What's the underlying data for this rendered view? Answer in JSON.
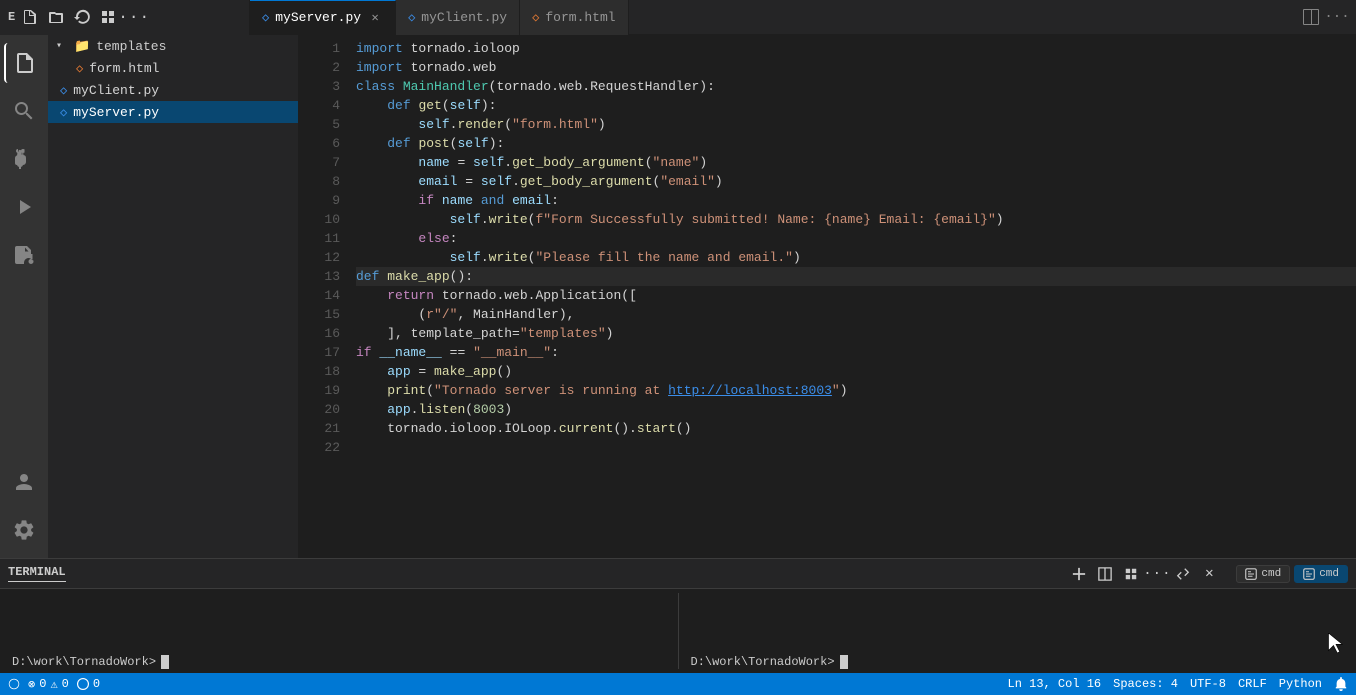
{
  "titlebar": {
    "explorer_label": "E",
    "buttons": [
      "new-file",
      "new-folder",
      "refresh",
      "collapse"
    ],
    "more_label": "..."
  },
  "tabs": [
    {
      "id": "myServer",
      "label": "myServer.py",
      "icon": "py",
      "active": true,
      "closable": true
    },
    {
      "id": "myClient",
      "label": "myClient.py",
      "icon": "py",
      "active": false,
      "closable": false
    },
    {
      "id": "form",
      "label": "form.html",
      "icon": "html",
      "active": false,
      "closable": false
    }
  ],
  "sidebar": {
    "tree": [
      {
        "type": "folder",
        "label": "templates",
        "expanded": true,
        "indent": 0
      },
      {
        "type": "file",
        "label": "form.html",
        "icon": "html",
        "indent": 1
      },
      {
        "type": "file",
        "label": "myClient.py",
        "icon": "py",
        "indent": 0
      },
      {
        "type": "file",
        "label": "myServer.py",
        "icon": "py",
        "indent": 0,
        "selected": true
      }
    ]
  },
  "editor": {
    "lines": [
      {
        "num": 1,
        "tokens": [
          {
            "t": "kw",
            "v": "import"
          },
          {
            "t": "plain",
            "v": " tornado.ioloop"
          }
        ]
      },
      {
        "num": 2,
        "tokens": [
          {
            "t": "kw",
            "v": "import"
          },
          {
            "t": "plain",
            "v": " tornado.web"
          }
        ]
      },
      {
        "num": 3,
        "tokens": [
          {
            "t": "kw",
            "v": "class"
          },
          {
            "t": "plain",
            "v": " "
          },
          {
            "t": "cls",
            "v": "MainHandler"
          },
          {
            "t": "plain",
            "v": "(tornado.web.RequestHandler):"
          }
        ]
      },
      {
        "num": 4,
        "tokens": [
          {
            "t": "plain",
            "v": "    "
          },
          {
            "t": "kw",
            "v": "def"
          },
          {
            "t": "plain",
            "v": " "
          },
          {
            "t": "fn",
            "v": "get"
          },
          {
            "t": "plain",
            "v": "("
          },
          {
            "t": "param",
            "v": "self"
          },
          {
            "t": "plain",
            "v": "):"
          }
        ]
      },
      {
        "num": 5,
        "tokens": [
          {
            "t": "plain",
            "v": "        "
          },
          {
            "t": "var",
            "v": "self"
          },
          {
            "t": "plain",
            "v": "."
          },
          {
            "t": "fn",
            "v": "render"
          },
          {
            "t": "plain",
            "v": "("
          },
          {
            "t": "str",
            "v": "\"form.html\""
          },
          {
            "t": "plain",
            "v": ")"
          }
        ]
      },
      {
        "num": 6,
        "tokens": [
          {
            "t": "plain",
            "v": "    "
          },
          {
            "t": "kw",
            "v": "def"
          },
          {
            "t": "plain",
            "v": " "
          },
          {
            "t": "fn",
            "v": "post"
          },
          {
            "t": "plain",
            "v": "("
          },
          {
            "t": "param",
            "v": "self"
          },
          {
            "t": "plain",
            "v": "):"
          }
        ]
      },
      {
        "num": 7,
        "tokens": [
          {
            "t": "plain",
            "v": "        "
          },
          {
            "t": "var",
            "v": "name"
          },
          {
            "t": "plain",
            "v": " = "
          },
          {
            "t": "var",
            "v": "self"
          },
          {
            "t": "plain",
            "v": "."
          },
          {
            "t": "fn",
            "v": "get_body_argument"
          },
          {
            "t": "plain",
            "v": "("
          },
          {
            "t": "str",
            "v": "\"name\""
          },
          {
            "t": "plain",
            "v": ")"
          }
        ]
      },
      {
        "num": 8,
        "tokens": [
          {
            "t": "plain",
            "v": "        "
          },
          {
            "t": "var",
            "v": "email"
          },
          {
            "t": "plain",
            "v": " = "
          },
          {
            "t": "var",
            "v": "self"
          },
          {
            "t": "plain",
            "v": "."
          },
          {
            "t": "fn",
            "v": "get_body_argument"
          },
          {
            "t": "plain",
            "v": "("
          },
          {
            "t": "str",
            "v": "\"email\""
          },
          {
            "t": "plain",
            "v": ")"
          }
        ]
      },
      {
        "num": 9,
        "tokens": [
          {
            "t": "plain",
            "v": "        "
          },
          {
            "t": "kw2",
            "v": "if"
          },
          {
            "t": "plain",
            "v": " "
          },
          {
            "t": "var",
            "v": "name"
          },
          {
            "t": "plain",
            "v": " "
          },
          {
            "t": "kw",
            "v": "and"
          },
          {
            "t": "plain",
            "v": " "
          },
          {
            "t": "var",
            "v": "email"
          },
          {
            "t": "plain",
            "v": ":"
          }
        ]
      },
      {
        "num": 10,
        "tokens": [
          {
            "t": "plain",
            "v": "            "
          },
          {
            "t": "var",
            "v": "self"
          },
          {
            "t": "plain",
            "v": "."
          },
          {
            "t": "fn",
            "v": "write"
          },
          {
            "t": "plain",
            "v": "("
          },
          {
            "t": "str2",
            "v": "f\"Form Successfully submitted! Name: {name} Email: {email}\""
          },
          {
            "t": "plain",
            "v": ")"
          }
        ]
      },
      {
        "num": 11,
        "tokens": [
          {
            "t": "plain",
            "v": "        "
          },
          {
            "t": "kw2",
            "v": "else"
          },
          {
            "t": "plain",
            "v": ":"
          }
        ]
      },
      {
        "num": 12,
        "tokens": [
          {
            "t": "plain",
            "v": "            "
          },
          {
            "t": "var",
            "v": "self"
          },
          {
            "t": "plain",
            "v": "."
          },
          {
            "t": "fn",
            "v": "write"
          },
          {
            "t": "plain",
            "v": "("
          },
          {
            "t": "str",
            "v": "\"Please fill the name and email.\""
          },
          {
            "t": "plain",
            "v": ")"
          }
        ]
      },
      {
        "num": 13,
        "tokens": [
          {
            "t": "kw",
            "v": "def"
          },
          {
            "t": "plain",
            "v": " "
          },
          {
            "t": "fn",
            "v": "make_app"
          },
          {
            "t": "plain",
            "v": "():"
          }
        ],
        "highlight": true
      },
      {
        "num": 14,
        "tokens": [
          {
            "t": "plain",
            "v": "    "
          },
          {
            "t": "kw2",
            "v": "return"
          },
          {
            "t": "plain",
            "v": " tornado.web.Application(["
          }
        ]
      },
      {
        "num": 15,
        "tokens": [
          {
            "t": "plain",
            "v": "        ("
          },
          {
            "t": "str",
            "v": "r\"/\""
          },
          {
            "t": "plain",
            "v": ", MainHandler),"
          }
        ]
      },
      {
        "num": 16,
        "tokens": [
          {
            "t": "plain",
            "v": "    ], template_path="
          },
          {
            "t": "str",
            "v": "\"templates\""
          },
          {
            "t": "plain",
            "v": ")"
          }
        ]
      },
      {
        "num": 17,
        "tokens": [
          {
            "t": "kw2",
            "v": "if"
          },
          {
            "t": "plain",
            "v": " "
          },
          {
            "t": "var",
            "v": "__name__"
          },
          {
            "t": "plain",
            "v": " == "
          },
          {
            "t": "str",
            "v": "\"__main__\""
          },
          {
            "t": "plain",
            "v": ":"
          }
        ]
      },
      {
        "num": 18,
        "tokens": [
          {
            "t": "plain",
            "v": "    "
          },
          {
            "t": "var",
            "v": "app"
          },
          {
            "t": "plain",
            "v": " = "
          },
          {
            "t": "fn",
            "v": "make_app"
          },
          {
            "t": "plain",
            "v": "()"
          }
        ]
      },
      {
        "num": 19,
        "tokens": [
          {
            "t": "plain",
            "v": "    "
          },
          {
            "t": "fn",
            "v": "print"
          },
          {
            "t": "plain",
            "v": "("
          },
          {
            "t": "str",
            "v": "\"Tornado server is running at "
          },
          {
            "t": "url",
            "v": "http://localhost:8003"
          },
          {
            "t": "str",
            "v": "\""
          },
          {
            "t": "plain",
            "v": ")"
          }
        ]
      },
      {
        "num": 20,
        "tokens": [
          {
            "t": "plain",
            "v": "    "
          },
          {
            "t": "var",
            "v": "app"
          },
          {
            "t": "plain",
            "v": "."
          },
          {
            "t": "fn",
            "v": "listen"
          },
          {
            "t": "plain",
            "v": "("
          },
          {
            "t": "num",
            "v": "8003"
          },
          {
            "t": "plain",
            "v": ")"
          }
        ]
      },
      {
        "num": 21,
        "tokens": [
          {
            "t": "plain",
            "v": "    tornado.ioloop.IOLoop."
          },
          {
            "t": "fn",
            "v": "current"
          },
          {
            "t": "plain",
            "v": "()."
          },
          {
            "t": "fn",
            "v": "start"
          },
          {
            "t": "plain",
            "v": "()"
          }
        ]
      },
      {
        "num": 22,
        "tokens": [
          {
            "t": "plain",
            "v": ""
          }
        ]
      }
    ]
  },
  "terminal": {
    "label": "TERMINAL",
    "panel1": {
      "prompt": "D:\\work\\TornadoWork>"
    },
    "panel2": {
      "prompt": "D:\\work\\TornadoWork>"
    },
    "cmd_label": "cmd",
    "panels": [
      {
        "label": "cmd",
        "active": false
      },
      {
        "label": "cmd",
        "active": true
      }
    ]
  },
  "statusbar": {
    "remote": "",
    "errors": "0",
    "warnings": "0",
    "port": "0",
    "position": "Ln 13, Col 16",
    "spaces": "Spaces: 4",
    "encoding": "UTF-8",
    "line_ending": "CRLF",
    "language": "Python",
    "bell": ""
  }
}
